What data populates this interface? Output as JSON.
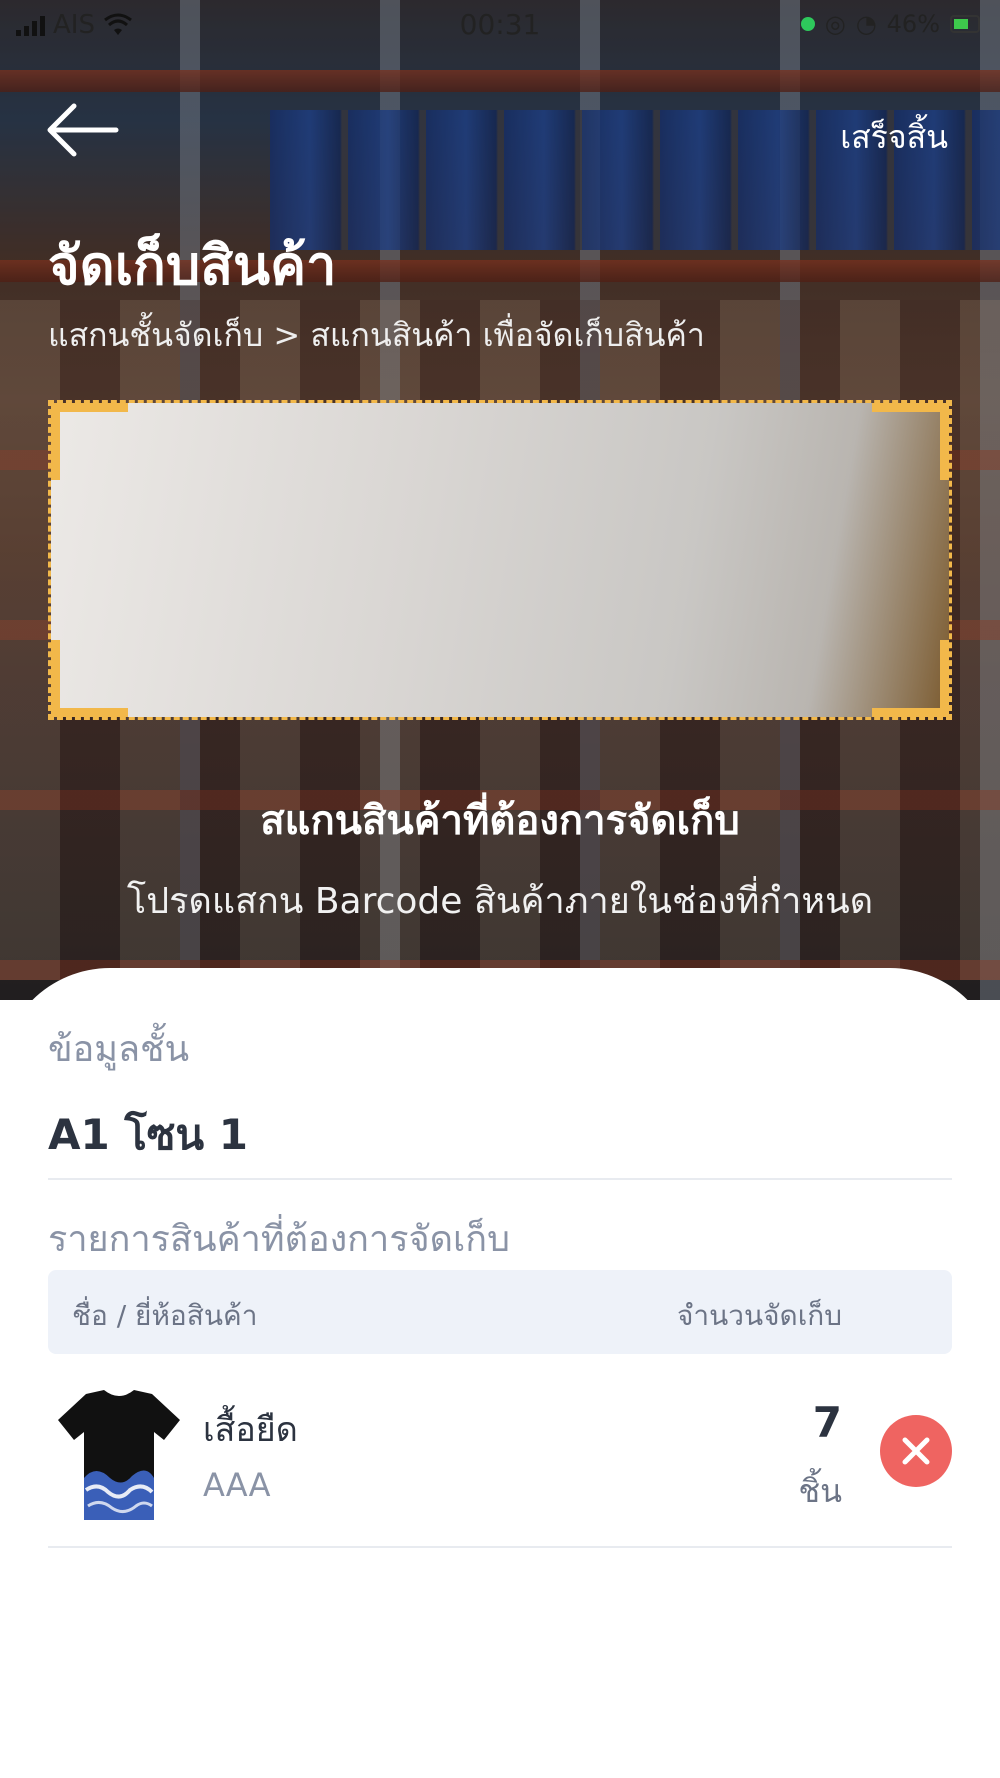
{
  "status_bar": {
    "carrier": "AIS",
    "time": "00:31",
    "battery": "46%"
  },
  "header": {
    "done_label": "เสร็จสิ้น",
    "title": "จัดเก็บสินค้า",
    "breadcrumb": "แสกนชั้นจัดเก็บ > สแกนสินค้า เพื่อจัดเก็บสินค้า"
  },
  "scanner": {
    "title": "สแกนสินค้าที่ต้องการจัดเก็บ",
    "hint": "โปรดแสกน Barcode สินค้าภายในช่องที่กำหนด",
    "frame_color": "#f2b84a"
  },
  "shelf": {
    "label": "ข้อมูลชั้น",
    "value": "A1 โซน 1"
  },
  "items": {
    "label": "รายการสินค้าที่ต้องการจัดเก็บ",
    "columns": {
      "name": "ชื่อ / ยี่ห้อสินค้า",
      "qty": "จำนวนจัดเก็บ"
    },
    "rows": [
      {
        "name": "เสื้อยืด",
        "brand": "AAA",
        "qty": "7",
        "unit": "ชิ้น",
        "thumb_icon": "tshirt-thumbnail"
      }
    ]
  },
  "colors": {
    "accent": "#f2b84a",
    "remove": "#ef6461",
    "muted_text": "#8a93a6",
    "table_header_bg": "#eef2f9"
  }
}
